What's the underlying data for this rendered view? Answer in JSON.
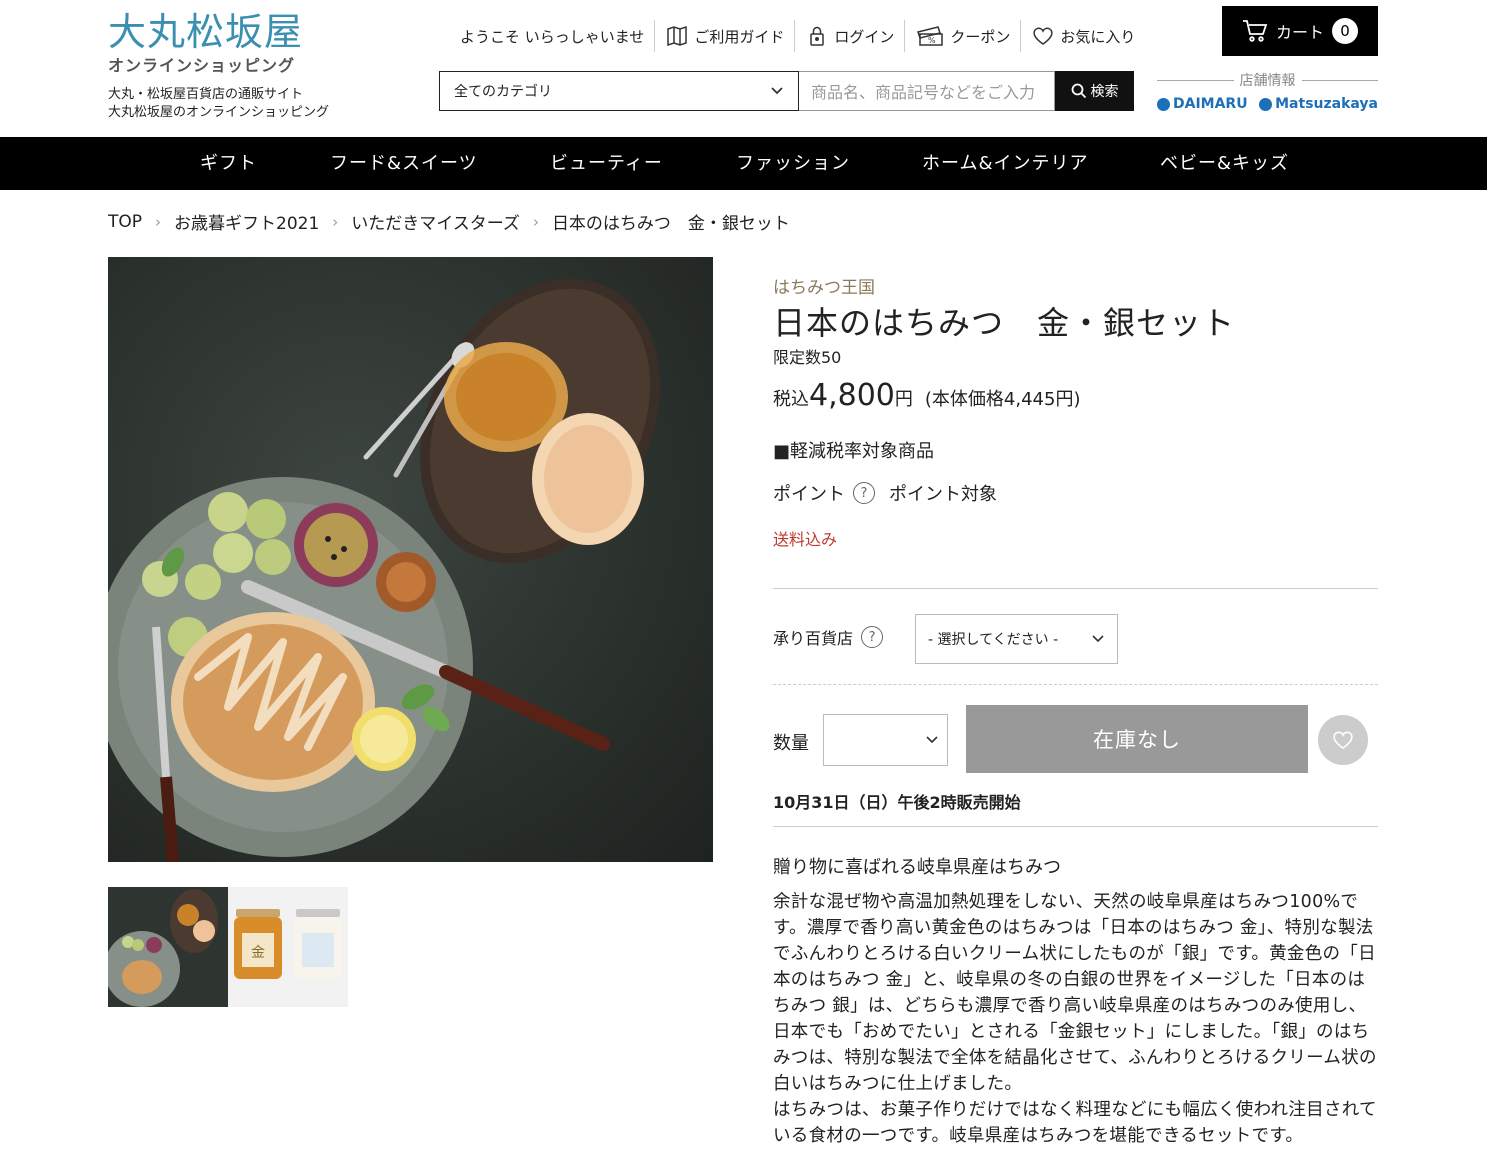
{
  "header": {
    "logo_main": "大丸松坂屋",
    "logo_sub": "オンラインショッピング",
    "tagline_1": "大丸・松坂屋百貨店の通販サイト",
    "tagline_2": "大丸松坂屋のオンラインショッピング",
    "welcome": "ようこそ いらっしゃいませ",
    "guide": "ご利用ガイド",
    "login": "ログイン",
    "coupon": "クーポン",
    "favorites": "お気に入り",
    "cart_label": "カート",
    "cart_count": "0",
    "category_select": "全てのカテゴリ",
    "search_placeholder": "商品名、商品記号などをご入力",
    "search_button": "検索",
    "store_info": "店舗情報",
    "store_daimaru": "DAIMARU",
    "store_matsuzakaya": "Matsuzakaya"
  },
  "nav": [
    "ギフト",
    "フード&スイーツ",
    "ビューティー",
    "ファッション",
    "ホーム&インテリア",
    "ベビー&キッズ"
  ],
  "breadcrumb": [
    "TOP",
    "お歳暮ギフト2021",
    "いただきマイスターズ",
    "日本のはちみつ　金・銀セット"
  ],
  "product": {
    "brand": "はちみつ王国",
    "title": "日本のはちみつ　金・銀セット",
    "limit": "限定数50",
    "price_prefix": "税込",
    "price_amount": "4,800",
    "price_unit": "円",
    "price_base": "(本体価格4,445円)",
    "tax_note": "■軽減税率対象商品",
    "points_label": "ポイント",
    "points_value": "ポイント対象",
    "shipping": "送料込み",
    "store_label": "承り百貨店",
    "store_select": "- 選択してください -",
    "qty_label": "数量",
    "stock_button": "在庫なし",
    "sale_date": "10月31日（日）午後2時販売開始",
    "desc_title": "贈り物に喜ばれる岐阜県産はちみつ",
    "desc_body_1": "余計な混ぜ物や高温加熱処理をしない、天然の岐阜県産はちみつ100%です。濃厚で香り高い黄金色のはちみつは「日本のはちみつ 金」、特別な製法でふんわりとろける白いクリーム状にしたものが「銀」です。黄金色の「日本のはちみつ 金」と、岐阜県の冬の白銀の世界をイメージした「日本のはちみつ 銀」は、どちらも濃厚で香り高い岐阜県産のはちみつのみ使用し、日本でも「おめでたい」とされる「金銀セット」にしました。「銀」のはちみつは、特別な製法で全体を結晶化させて、ふんわりとろけるクリーム状の白いはちみつに仕上げました。",
    "desc_body_2": "はちみつは、お菓子作りだけではなく料理などにも幅広く使われ注目されている食材の一つです。岐阜県産はちみつを堪能できるセットです。"
  }
}
